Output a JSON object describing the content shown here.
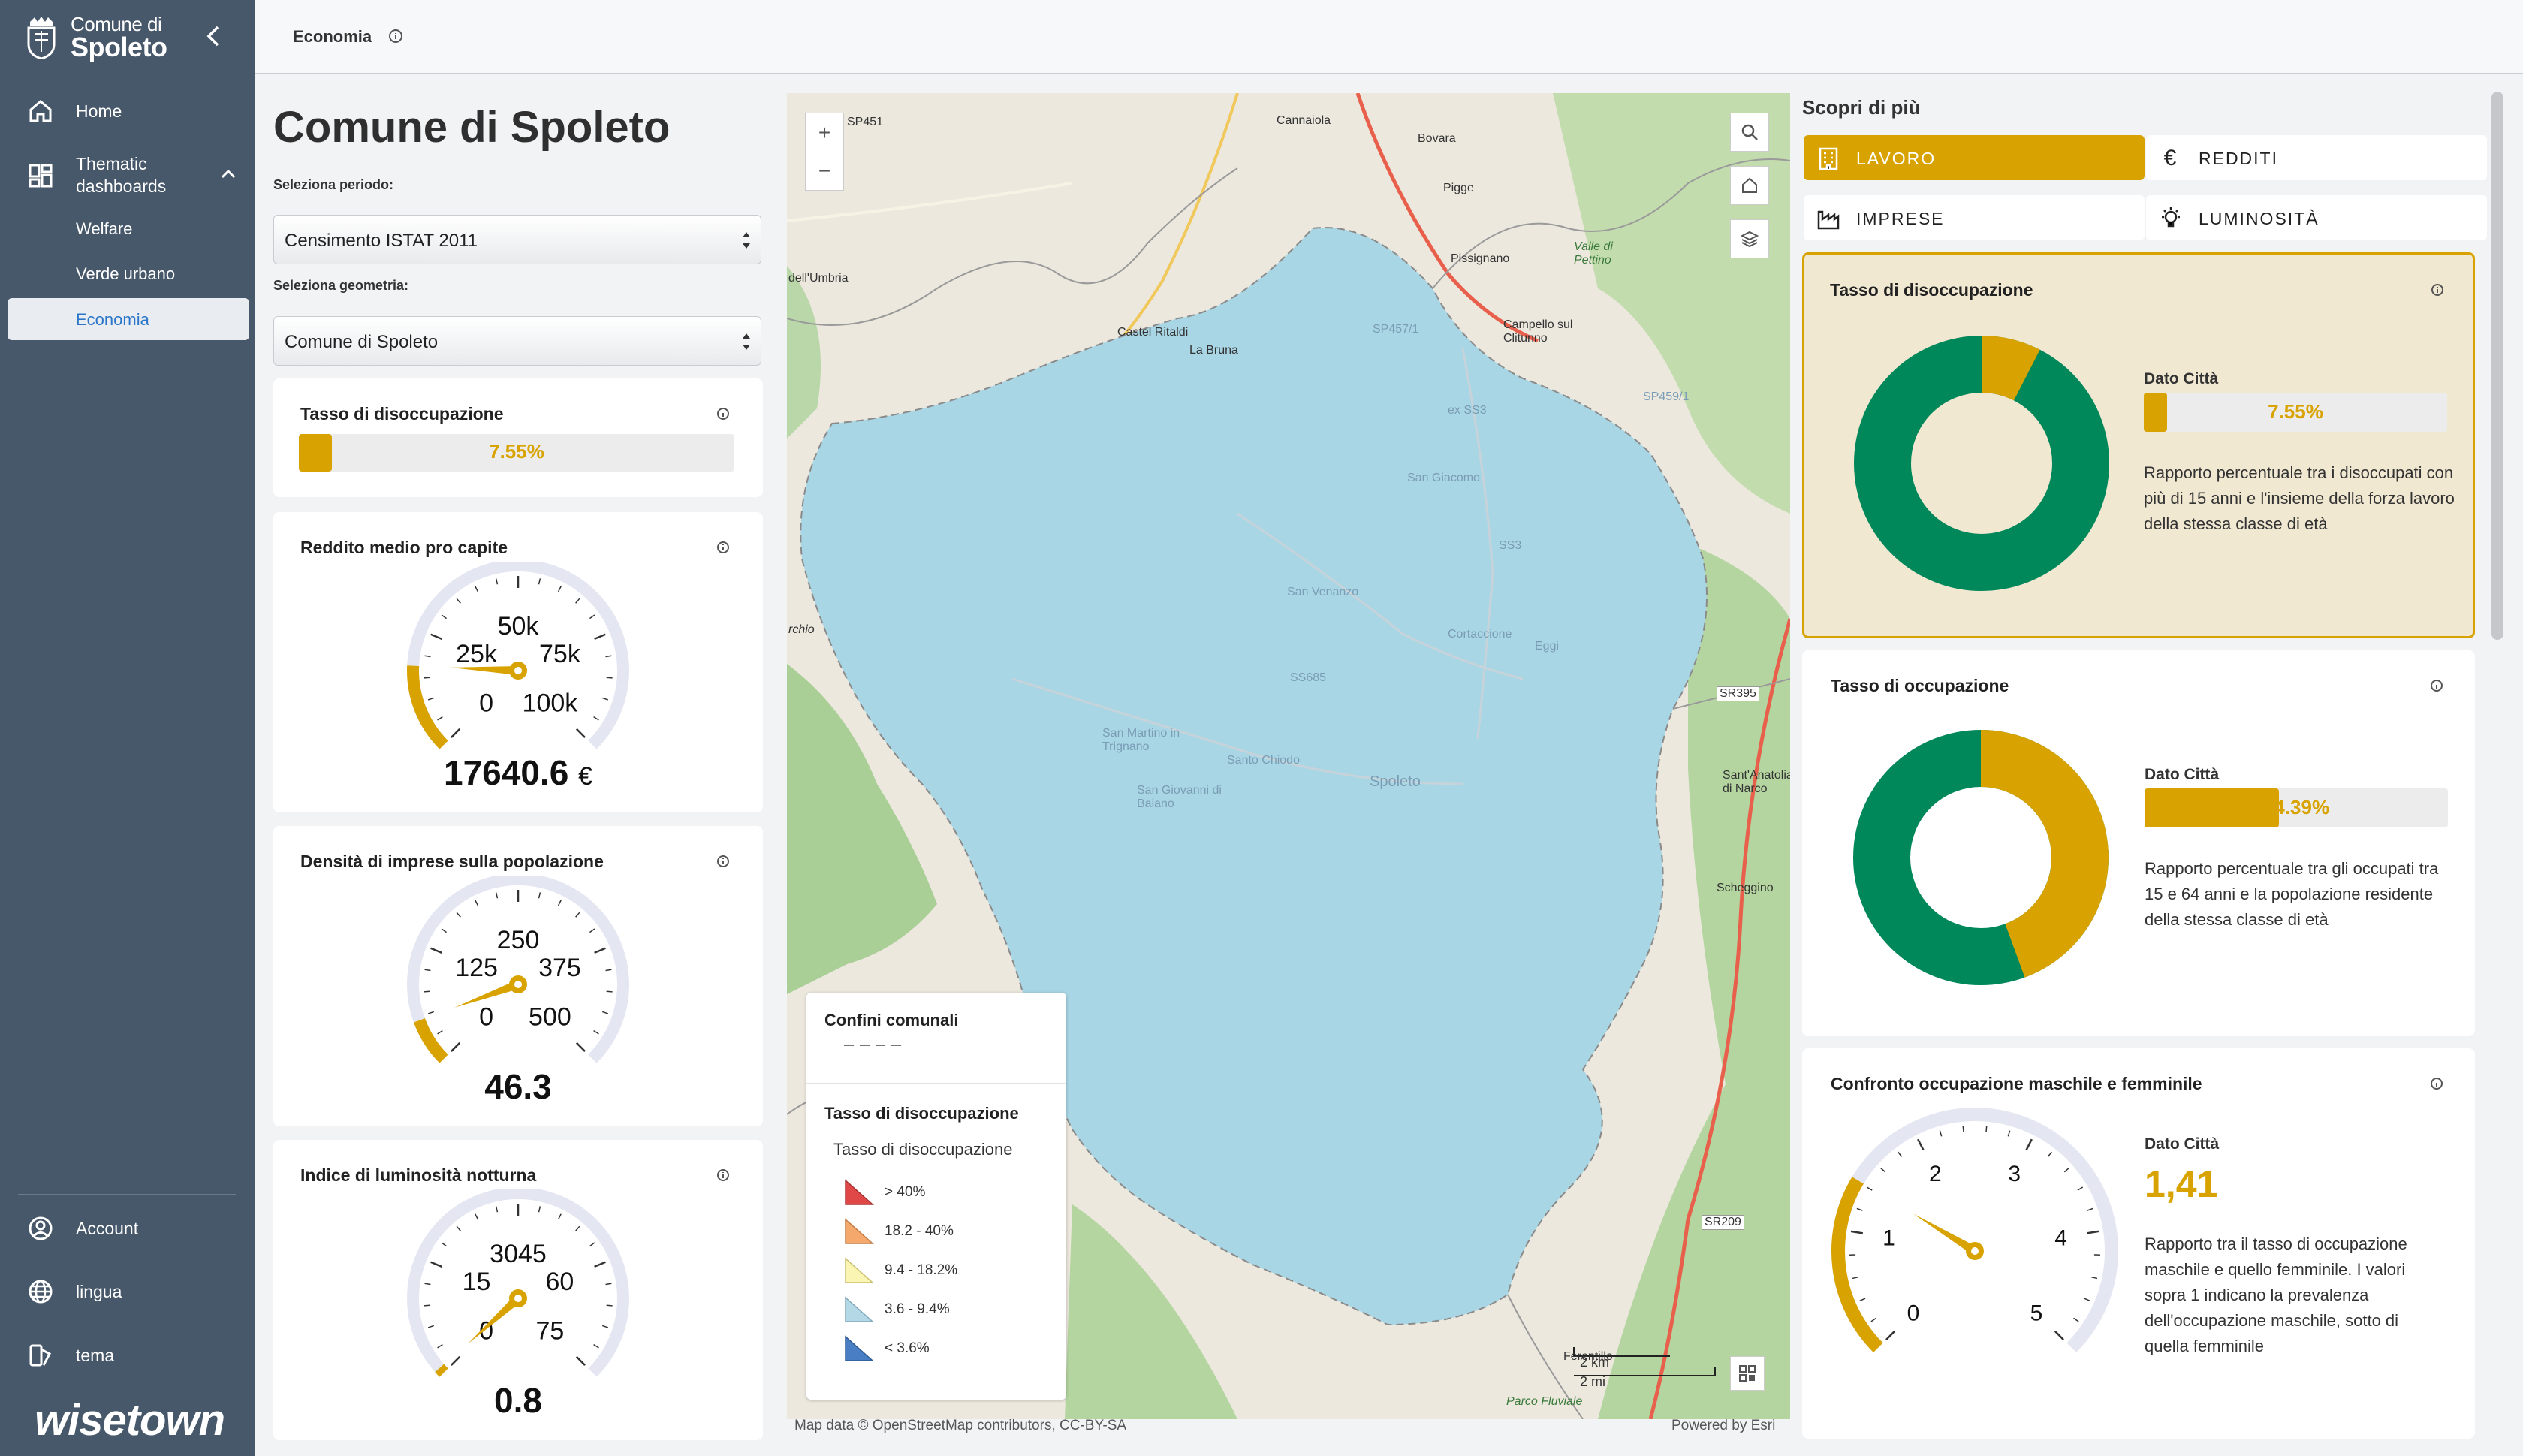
{
  "sidebar": {
    "logo": {
      "line1": "Comune di",
      "line2": "Spoleto"
    },
    "nav": [
      {
        "label": "Home",
        "icon": "home-icon"
      },
      {
        "label": "Thematic dashboards",
        "icon": "dashboard-icon"
      }
    ],
    "subnav": [
      "Welfare",
      "Verde urbano",
      "Economia"
    ],
    "bottom": [
      {
        "label": "Account",
        "icon": "account-icon"
      },
      {
        "label": "lingua",
        "icon": "globe-icon"
      },
      {
        "label": "tema",
        "icon": "theme-icon"
      }
    ],
    "brand": "wisetown"
  },
  "header": {
    "title": "Economia"
  },
  "left": {
    "title": "Comune di Spoleto",
    "period_label": "Seleziona periodo:",
    "period_value": "Censimento ISTAT 2011",
    "geometry_label": "Seleziona geometria:",
    "geometry_value": "Comune di Spoleto",
    "cards": {
      "disoccupazione": {
        "title": "Tasso di disoccupazione",
        "value": "7.55%",
        "fraction": 0.0755
      },
      "reddito": {
        "title": "Reddito medio pro capite",
        "value": "17640.6",
        "unit": "€",
        "ticks": [
          "0",
          "25k",
          "50k",
          "75k",
          "100k"
        ],
        "min": 0,
        "max": 100000,
        "reading": 17640.6
      },
      "imprese": {
        "title": "Densità di imprese sulla popolazione",
        "value": "46.3",
        "ticks": [
          "0",
          "125",
          "250",
          "375",
          "500"
        ],
        "min": 0,
        "max": 500,
        "reading": 46.3
      },
      "luminosita": {
        "title": "Indice di luminosità notturna",
        "value": "0.8",
        "ticks": [
          "0",
          "15",
          "3045",
          "60",
          "75"
        ],
        "min": 0,
        "max": 75,
        "reading": 0.8
      }
    }
  },
  "map": {
    "legend": {
      "boundaries_title": "Confini comunali",
      "layer_title": "Tasso di disoccupazione",
      "sub_title": "Tasso di disoccupazione",
      "items": [
        {
          "label": "> 40%",
          "color": "#e04848"
        },
        {
          "label": "18.2 - 40%",
          "color": "#f5a86c"
        },
        {
          "label": "9.4 - 18.2%",
          "color": "#fbf5b4"
        },
        {
          "label": "3.6 - 9.4%",
          "color": "#b4d8e6"
        },
        {
          "label": "< 3.6%",
          "color": "#4a7ec4"
        }
      ]
    },
    "places": [
      "SP451",
      "Cannaiola",
      "Bovara",
      "Pigge",
      "Pissignano",
      "Valle di Pettino",
      "dell'Umbria",
      "Castel Ritaldi",
      "La Bruna",
      "Campello sul Clitunno",
      "SP457/1",
      "SP459/1",
      "ex SS3",
      "San Giacomo",
      "SS3",
      "San Venanzo",
      "Cortaccione",
      "Eggi",
      "SR395",
      "rchio",
      "SS685",
      "San Martino in Trignano",
      "Santo Chiodo",
      "Spoleto",
      "San Giovanni di Baiano",
      "Sant'Anatolia di Narco",
      "Scheggino",
      "SR209",
      "Ferentillo",
      "Parco Fluviale"
    ],
    "scale": [
      "2 km",
      "2 mi"
    ],
    "credit_left": "Map data © OpenStreetMap contributors, CC-BY-SA",
    "credit_right": "Powered by Esri"
  },
  "right": {
    "heading": "Scopri di più",
    "tabs": [
      {
        "label": "LAVORO",
        "icon": "building-icon",
        "active": true
      },
      {
        "label": "REDDITI",
        "icon": "euro-icon",
        "active": false
      },
      {
        "label": "IMPRESE",
        "icon": "factory-icon",
        "active": false
      },
      {
        "label": "LUMINOSITÀ",
        "icon": "lightbulb-icon",
        "active": false
      }
    ],
    "dato_label": "Dato Città",
    "cards": {
      "disoccupazione": {
        "title": "Tasso di disoccupazione",
        "value": "7.55%",
        "fraction": 0.0755,
        "desc": "Rapporto percentuale tra i disoccupati con più di 15 anni e l'insieme della forza lavoro della stessa classe di età"
      },
      "occupazione": {
        "title": "Tasso di occupazione",
        "value": "44.39%",
        "fraction": 0.4439,
        "desc": "Rapporto percentuale tra gli occupati tra 15 e 64 anni e la popolazione residente della stessa classe di età"
      },
      "confronto": {
        "title": "Confronto occupazione maschile e femminile",
        "value": "1,41",
        "reading": 1.41,
        "min": 0,
        "max": 5,
        "ticks": [
          "0",
          "1",
          "2",
          "3",
          "4",
          "5"
        ],
        "desc": "Rapporto tra il tasso di occupazione maschile e quello femminile. I valori sopra 1 indicano la prevalenza dell'occupazione maschile, sotto di quella femminile"
      }
    },
    "colors": {
      "accent": "#d8a300",
      "green": "#00875a"
    }
  }
}
